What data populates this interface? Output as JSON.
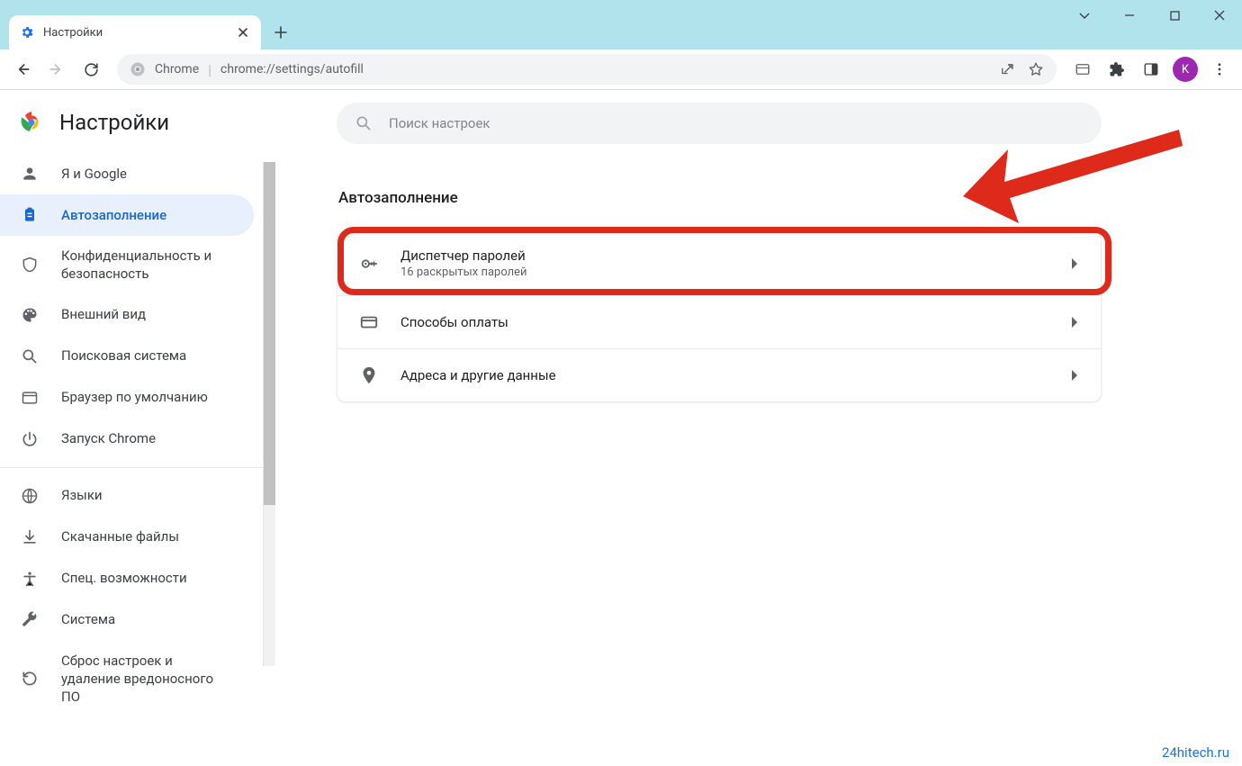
{
  "tab": {
    "title": "Настройки"
  },
  "omnibox": {
    "prefix": "Chrome",
    "url": "chrome://settings/autofill"
  },
  "avatar_letter": "K",
  "sidebar": {
    "title": "Настройки",
    "items": [
      {
        "label": "Я и Google"
      },
      {
        "label": "Автозаполнение"
      },
      {
        "label": "Конфиденциальность и безопасность"
      },
      {
        "label": "Внешний вид"
      },
      {
        "label": "Поисковая система"
      },
      {
        "label": "Браузер по умолчанию"
      },
      {
        "label": "Запуск Chrome"
      }
    ],
    "items2": [
      {
        "label": "Языки"
      },
      {
        "label": "Скачанные файлы"
      },
      {
        "label": "Спец. возможности"
      },
      {
        "label": "Система"
      },
      {
        "label": "Сброс настроек и удаление вредоносного ПО"
      }
    ]
  },
  "search": {
    "placeholder": "Поиск настроек"
  },
  "section": {
    "heading": "Автозаполнение"
  },
  "card": {
    "rows": [
      {
        "title": "Диспетчер паролей",
        "sub": "16 раскрытых паролей"
      },
      {
        "title": "Способы оплаты"
      },
      {
        "title": "Адреса и другие данные"
      }
    ]
  },
  "colors": {
    "accent": "#1967d2",
    "highlight": "#dd2a1b",
    "titlebar": "#b0e3ec"
  },
  "watermark": "24hitech.ru"
}
